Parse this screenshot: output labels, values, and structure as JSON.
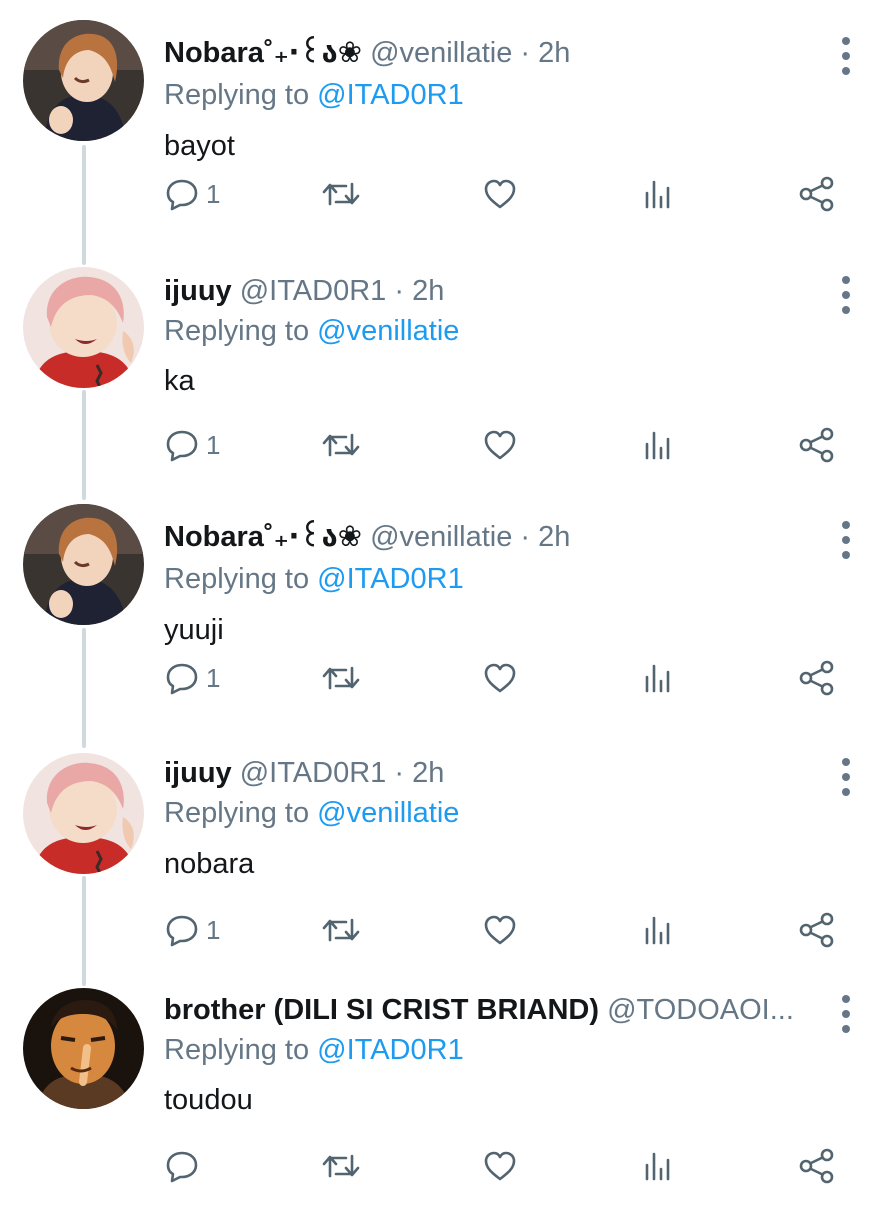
{
  "colors": {
    "mention": "#1d9bf0",
    "muted": "#657786",
    "thread_line": "#cfd9de"
  },
  "icons": {
    "reply": "reply-icon",
    "retweet": "retweet-icon",
    "like": "like-icon",
    "stats": "stats-icon",
    "share": "share-icon",
    "more": "more-vertical-icon"
  },
  "tweets": [
    {
      "name": "Nobara˚₊‧꒰ა❀",
      "handle": "@venillatie",
      "separator": "·",
      "time": "2h",
      "replying_prefix": "Replying to",
      "replying_to": "@ITAD0R1",
      "text": "bayot",
      "reply_count": "1",
      "avatar": "nobara"
    },
    {
      "name": "ijuuy",
      "handle": "@ITAD0R1",
      "separator": "·",
      "time": "2h",
      "replying_prefix": "Replying to",
      "replying_to": "@venillatie",
      "text": "ka",
      "reply_count": "1",
      "avatar": "yuuji"
    },
    {
      "name": "Nobara˚₊‧꒰ა❀",
      "handle": "@venillatie",
      "separator": "·",
      "time": "2h",
      "replying_prefix": "Replying to",
      "replying_to": "@ITAD0R1",
      "text": "yuuji",
      "reply_count": "1",
      "avatar": "nobara"
    },
    {
      "name": "ijuuy",
      "handle": "@ITAD0R1",
      "separator": "·",
      "time": "2h",
      "replying_prefix": "Replying to",
      "replying_to": "@venillatie",
      "text": "nobara",
      "reply_count": "1",
      "avatar": "yuuji"
    },
    {
      "name": "brother (DILI SI CRIST BRIAND)",
      "handle": "@TODOAOI...",
      "separator": "",
      "time": "",
      "replying_prefix": "Replying to",
      "replying_to": "@ITAD0R1",
      "text": "toudou",
      "reply_count": "",
      "avatar": "todo"
    }
  ]
}
